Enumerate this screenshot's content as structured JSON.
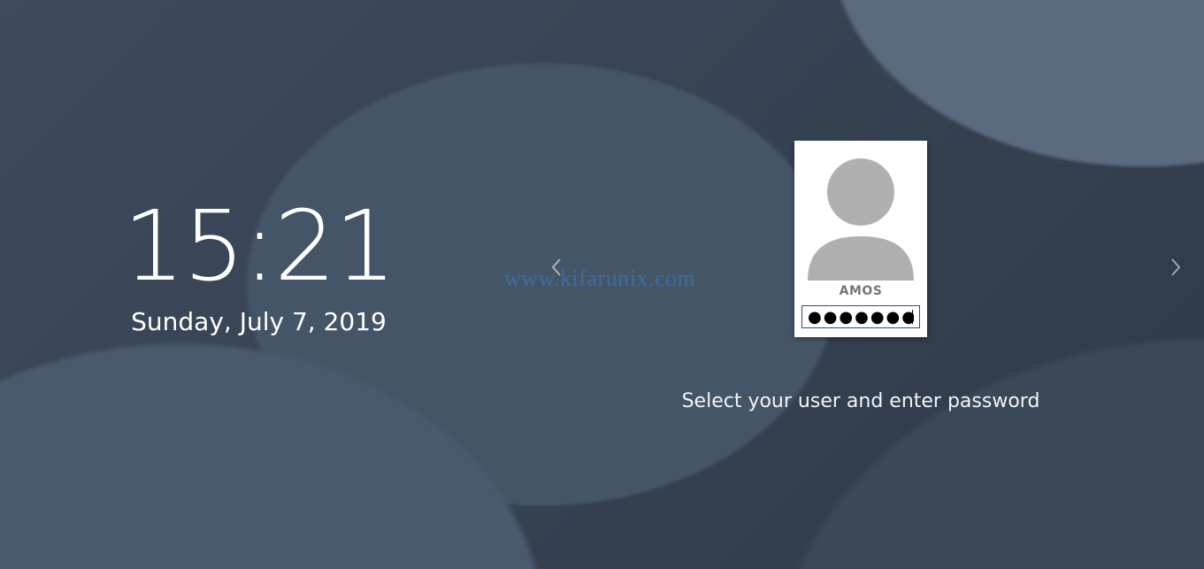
{
  "clock": {
    "time": "15:21",
    "date": "Sunday, July 7, 2019"
  },
  "login": {
    "username": "AMOS",
    "password_mask": "●●●●●●●●",
    "hint": "Select your user and enter password"
  },
  "watermark": "www.kifarunix.com"
}
